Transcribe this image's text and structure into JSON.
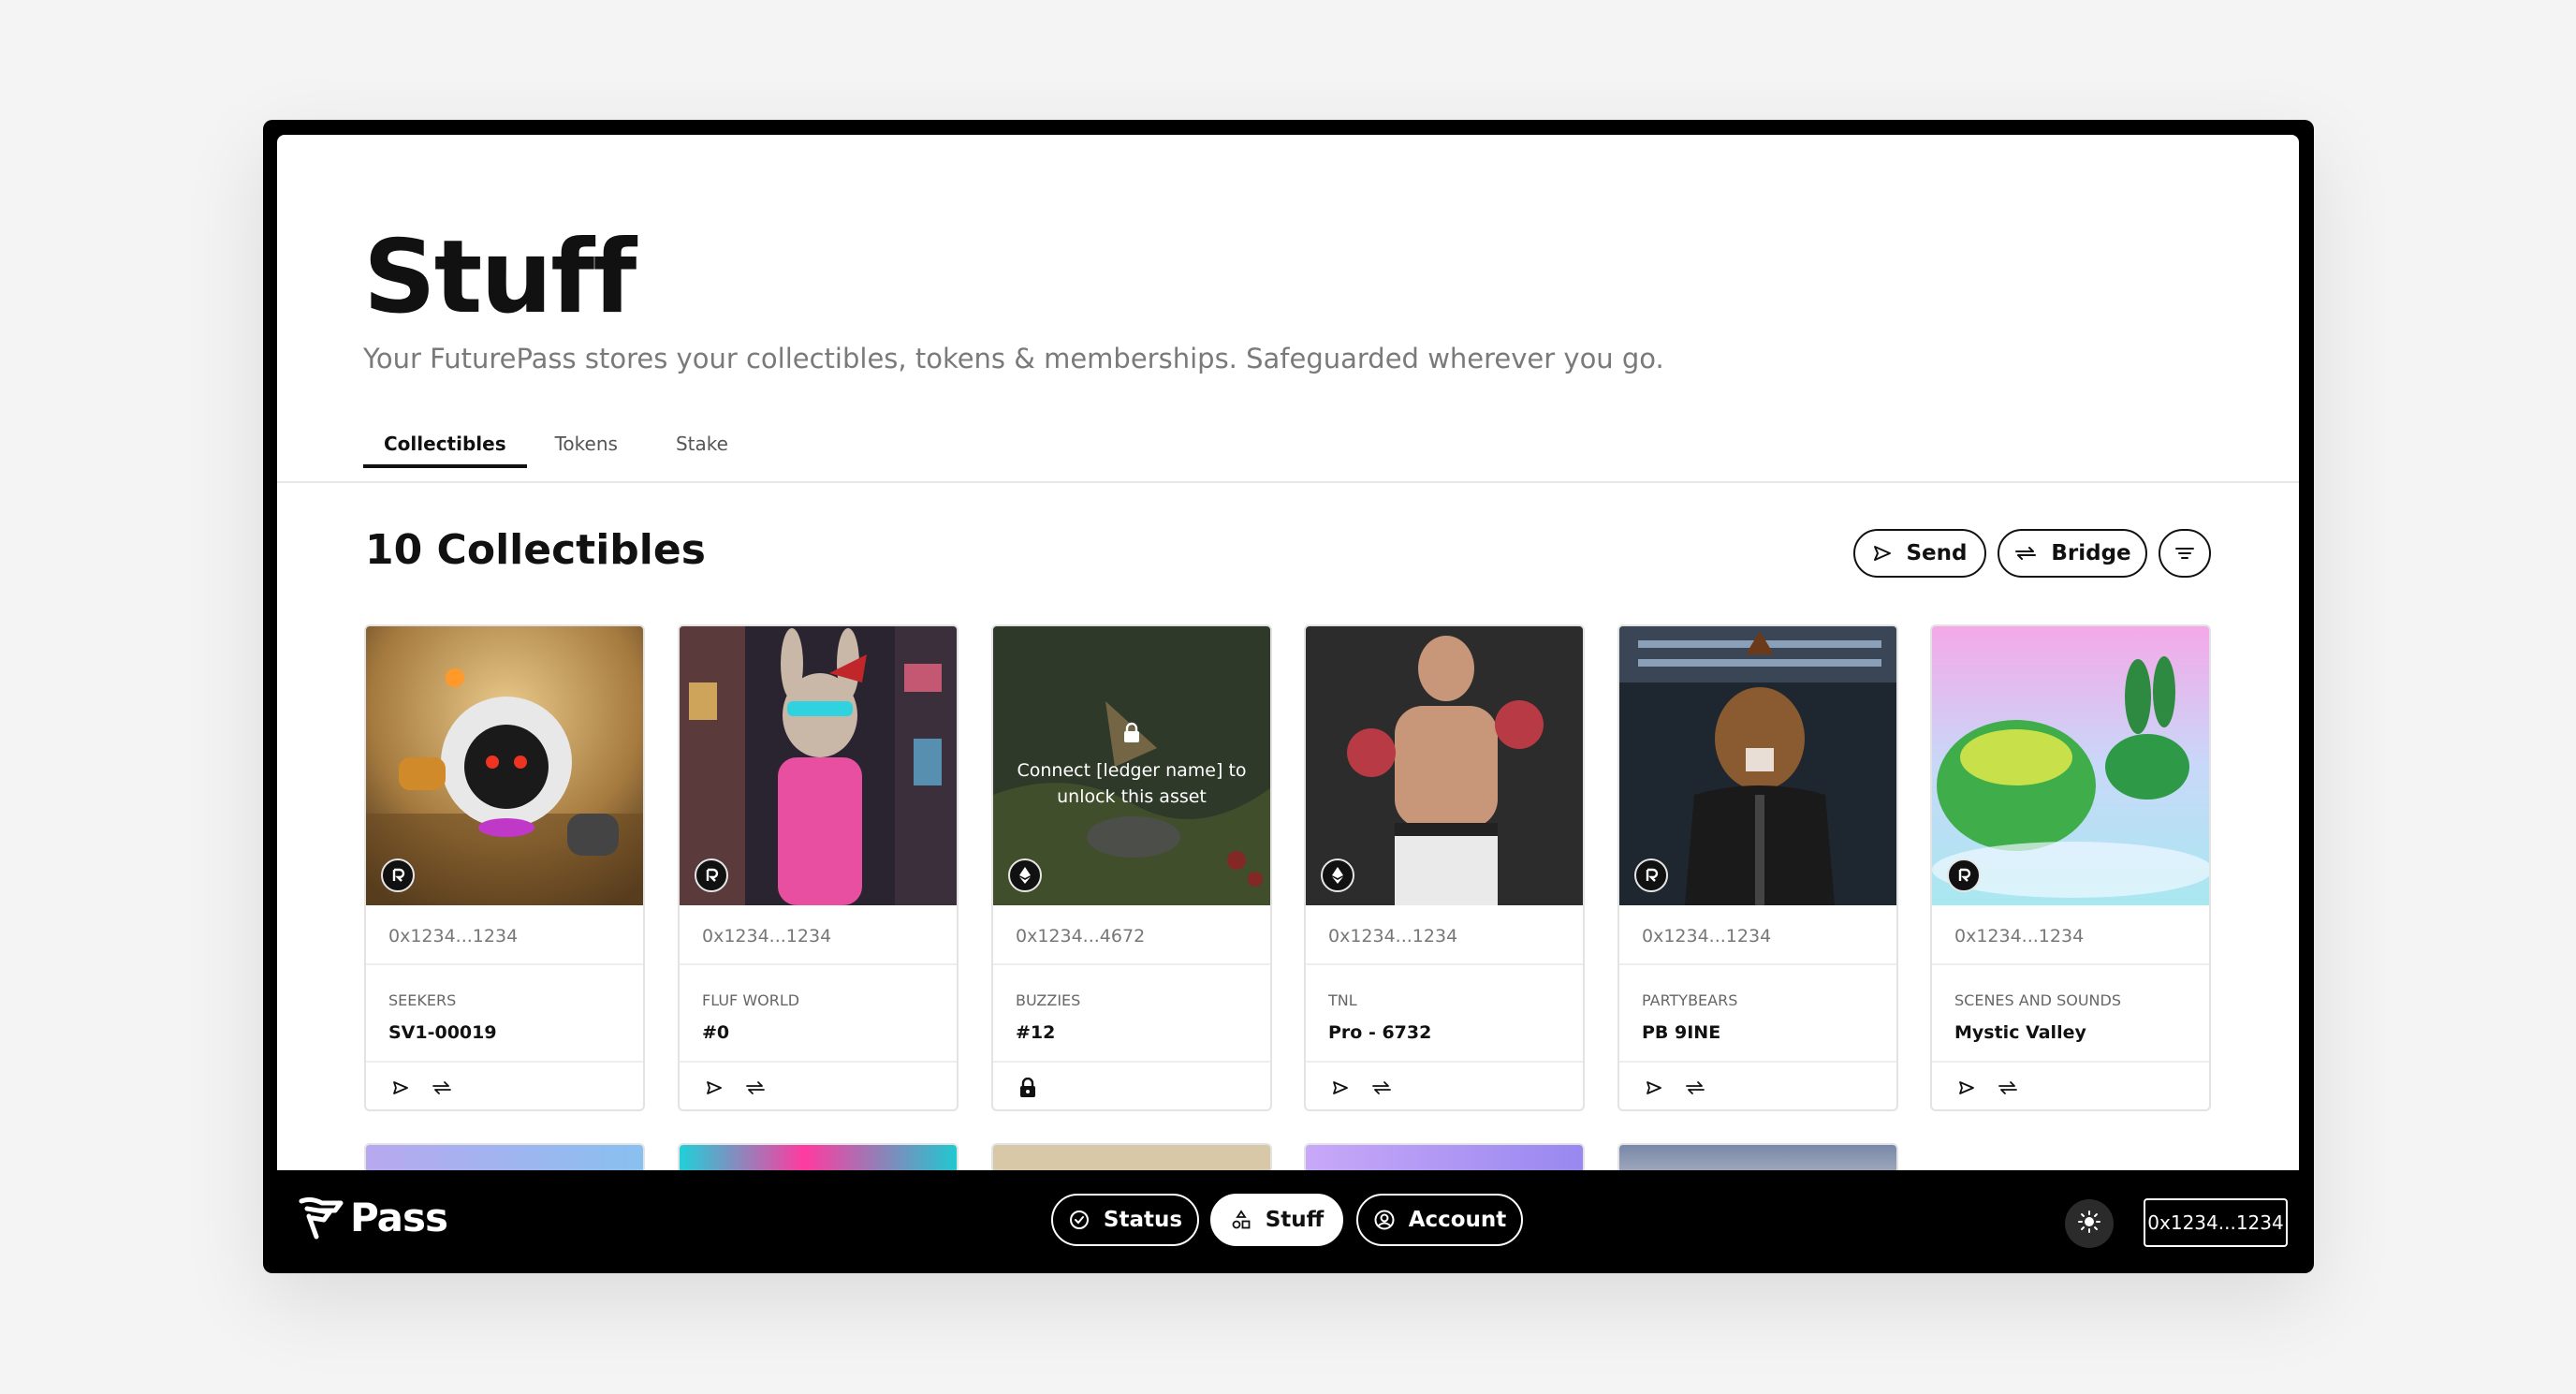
{
  "header": {
    "title": "Stuff",
    "subtitle": "Your FuturePass stores your collectibles, tokens & memberships. Safeguarded wherever you go."
  },
  "tabs": [
    {
      "label": "Collectibles",
      "active": true
    },
    {
      "label": "Tokens",
      "active": false
    },
    {
      "label": "Stake",
      "active": false
    }
  ],
  "collectibles": {
    "heading": "10 Collectibles",
    "send_label": "Send",
    "bridge_label": "Bridge",
    "sort_icon": "sort-icon",
    "items": [
      {
        "address": "0x1234...1234",
        "collection": "SEEKERS",
        "name": "SV1-00019",
        "chain": "root",
        "locked": false
      },
      {
        "address": "0x1234...1234",
        "collection": "FLUF WORLD",
        "name": "#0",
        "chain": "root",
        "locked": false
      },
      {
        "address": "0x1234...4672",
        "collection": "BUZZIES",
        "name": "#12",
        "chain": "ethereum",
        "locked": true,
        "lock_message": "Connect [ledger name] to unlock this asset"
      },
      {
        "address": "0x1234...1234",
        "collection": "TNL",
        "name": "Pro - 6732",
        "chain": "ethereum",
        "locked": false
      },
      {
        "address": "0x1234...1234",
        "collection": "PARTYBEARS",
        "name": "PB 9INE",
        "chain": "root",
        "locked": false
      },
      {
        "address": "0x1234...1234",
        "collection": "SCENES AND SOUNDS",
        "name": "Mystic Valley",
        "chain": "root",
        "locked": false
      }
    ]
  },
  "bottom_nav": {
    "logo_text": "Pass",
    "items": [
      {
        "label": "Status",
        "icon": "check-circle-icon",
        "active": false
      },
      {
        "label": "Stuff",
        "icon": "shapes-icon",
        "active": true
      },
      {
        "label": "Account",
        "icon": "user-circle-icon",
        "active": false
      }
    ],
    "theme_icon": "sun-icon",
    "wallet_address": "0x1234...1234"
  },
  "colors": {
    "accent": "#111111",
    "frame": "#000000",
    "muted_text": "#7a7a7a"
  }
}
